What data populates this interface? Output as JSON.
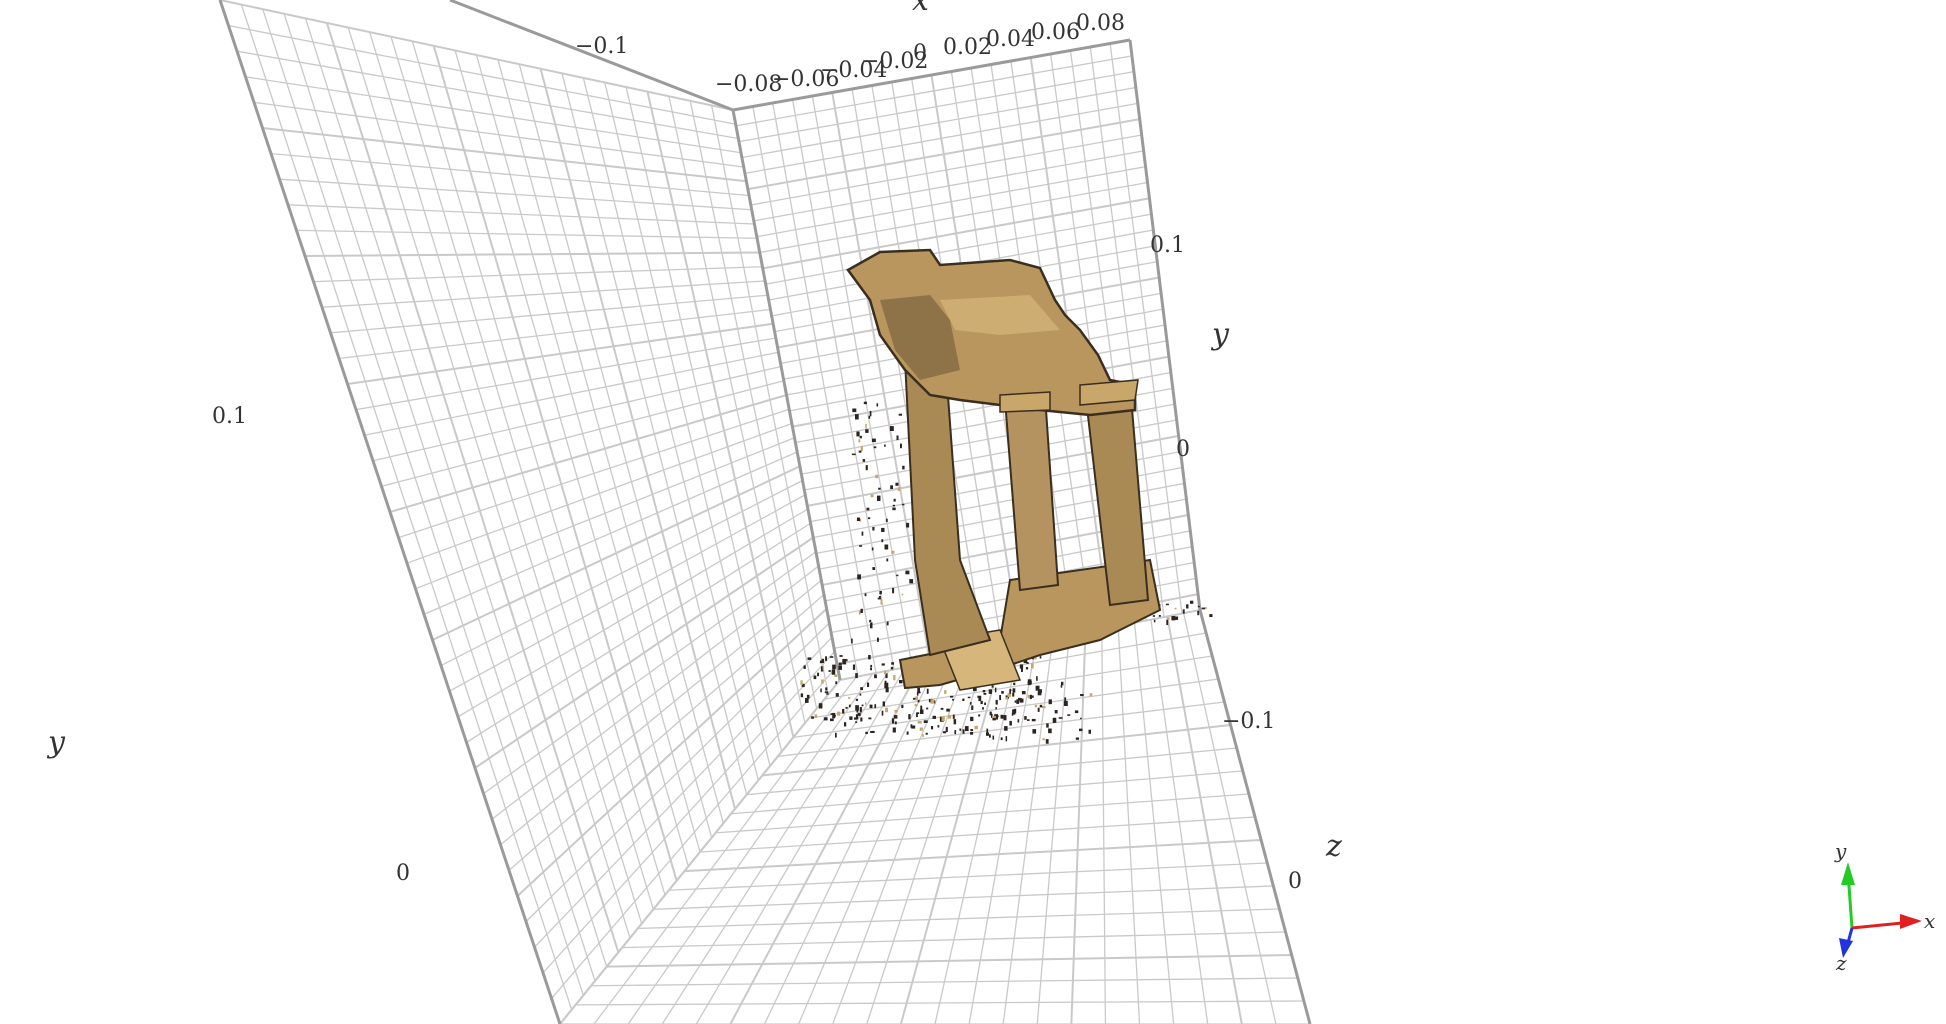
{
  "viewer": {
    "type": "3d-point-cloud-plot",
    "background": "#ffffff",
    "grid_color": "#c9c9c9",
    "grid_major_color": "#9a9a9a",
    "model_colors": {
      "stone_light": "#c9a76a",
      "stone_mid": "#a98a55",
      "stone_dark": "#6e5736",
      "outline": "#3a2e1e",
      "noise": "#2b2420"
    }
  },
  "axes": {
    "x": {
      "title": "x",
      "ticks": [
        "−0.08",
        "−0.06",
        "−0.04",
        "−0.02",
        "0",
        "0.02",
        "0.04",
        "0.06",
        "0.08"
      ]
    },
    "left_wall": {
      "title": "y",
      "ticks": [
        "−0.1",
        "0.1",
        "0"
      ]
    },
    "right_wall": {
      "title": "y",
      "ticks": [
        "0.1",
        "0"
      ]
    },
    "z": {
      "title": "z",
      "ticks": [
        "−0.1",
        "0"
      ]
    }
  },
  "gizmo": {
    "x_label": "x",
    "y_label": "y",
    "z_label": "z",
    "x_color": "#e02020",
    "y_color": "#22cc22",
    "z_color": "#2233dd"
  }
}
